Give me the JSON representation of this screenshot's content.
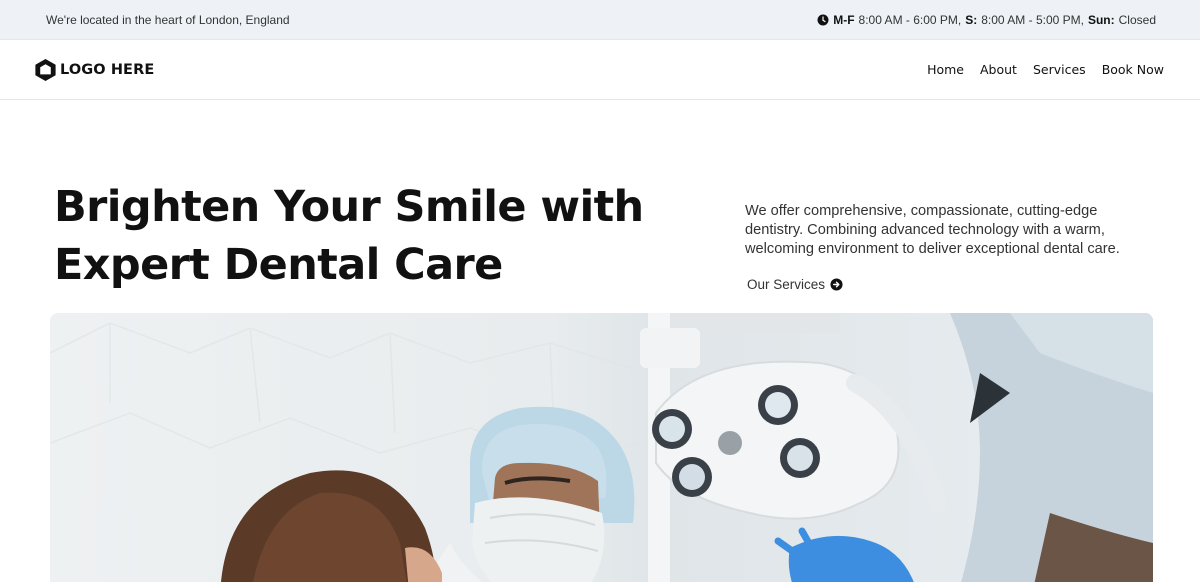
{
  "topbar": {
    "location": "We're located in the heart of London, England",
    "hours_mf_label": "M-F",
    "hours_mf": "8:00 AM - 6:00 PM,",
    "hours_s_label": "S:",
    "hours_s": "8:00 AM - 5:00 PM,",
    "hours_sun_label": "Sun:",
    "hours_sun": "Closed",
    "clock_icon": "clock-icon"
  },
  "header": {
    "logo_text": "LOGO HERE",
    "logo_icon": "hexagon-logo-icon",
    "nav": [
      {
        "label": "Home"
      },
      {
        "label": "About"
      },
      {
        "label": "Services"
      },
      {
        "label": "Book Now"
      }
    ]
  },
  "hero": {
    "title_line1": "Brighten Your Smile with",
    "title_line2": "Expert Dental Care",
    "description": "We offer comprehensive, compassionate, cutting-edge dentistry. Combining advanced technology with a warm, welcoming environment to deliver exceptional dental care.",
    "services_link": "Our Services",
    "services_icon": "arrow-right-circle-icon"
  },
  "colors": {
    "topbar_bg": "#eef2f6",
    "text": "#111111",
    "surgical_cap": "#bcd7e6",
    "glove": "#3d8ee0"
  }
}
